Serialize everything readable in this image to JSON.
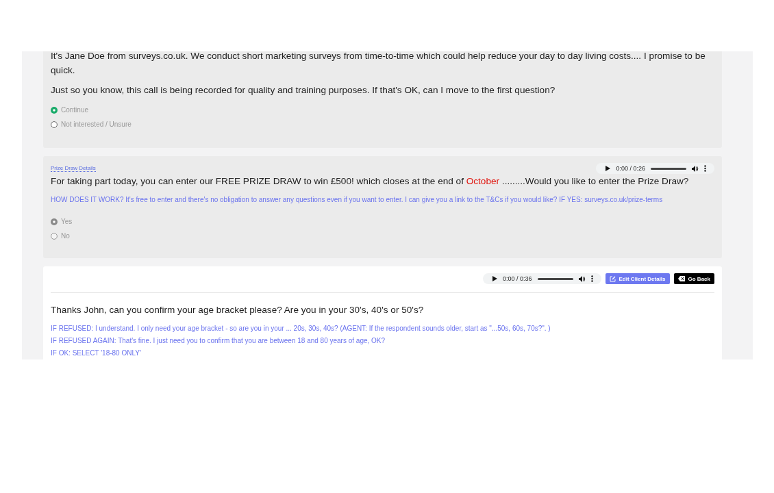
{
  "cards": [
    {
      "kind": "answered",
      "paragraphs": [
        [
          {
            "text": "It's Jane Doe from surveys.co.uk. We conduct short marketing surveys from time-to-time which could help reduce your day to day living costs.... I promise to be quick.",
            "highlight": false
          }
        ],
        [
          {
            "text": "Just so you know, this call is being recorded for quality and training purposes. If that's OK, can I move to the first question?",
            "highlight": false
          }
        ]
      ],
      "options": [
        {
          "label": "Continue",
          "selected": true,
          "disabled": false
        },
        {
          "label": "Not interested / Unsure",
          "selected": false,
          "disabled": false
        }
      ]
    },
    {
      "kind": "answered",
      "label": "Prize Draw Details",
      "audio": {
        "time": "0:00 / 0:26"
      },
      "paragraphs": [
        [
          {
            "text": "For taking part today, you can enter our FREE PRIZE DRAW to win £500! which closes at the end of ",
            "highlight": false
          },
          {
            "text": "October",
            "highlight": true
          },
          {
            "text": " .........Would you like to enter the Prize Draw?",
            "highlight": false
          }
        ]
      ],
      "notes": [
        "HOW DOES IT WORK? It's free to enter and there's no obligation to answer any questions even if you want to enter. I can give you a link to the T&Cs if you would like? IF YES: surveys.co.uk/prize-terms"
      ],
      "options": [
        {
          "label": "Yes",
          "selected": true,
          "disabled": true
        },
        {
          "label": "No",
          "selected": false,
          "disabled": true
        }
      ]
    },
    {
      "kind": "current",
      "audio": {
        "time": "0:00 / 0:36"
      },
      "actions": [
        {
          "label": "Edit Client Details",
          "kind": "edit"
        },
        {
          "label": "Go Back",
          "kind": "back"
        }
      ],
      "paragraphs": [
        [
          {
            "text": "Thanks John, can you confirm your age bracket please? Are you in your 30's, 40's or 50's?",
            "highlight": false
          }
        ]
      ],
      "notes": [
        "IF REFUSED: I understand. I only need your age bracket - so are you in your ... 20s, 30s, 40s? (AGENT: If the respondent sounds older, start as \"...50s, 60s, 70s?\". )",
        "IF REFUSED AGAIN: That's fine. I just need you to confirm that you are between 18 and 80 years of age, OK?",
        "IF OK: SELECT '18-80 ONLY'"
      ]
    }
  ]
}
